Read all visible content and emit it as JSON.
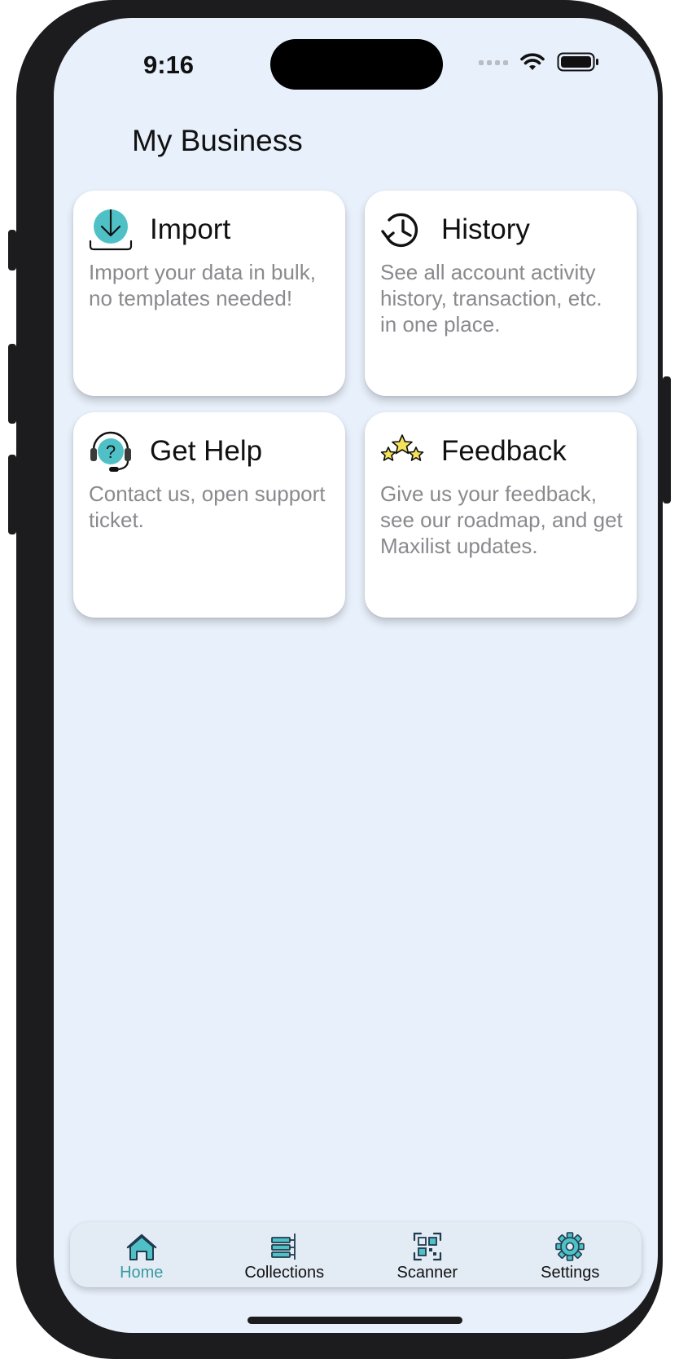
{
  "status_bar": {
    "time": "9:16"
  },
  "header": {
    "title": "My Business"
  },
  "cards": [
    {
      "title": "Import",
      "description": "Import your data in bulk, no templates needed!",
      "icon": "download-icon"
    },
    {
      "title": "History",
      "description": "See all account activity history, transaction, etc. in one place.",
      "icon": "history-clock-icon"
    },
    {
      "title": "Get Help",
      "description": "Contact us, open support ticket.",
      "icon": "headset-help-icon"
    },
    {
      "title": "Feedback",
      "description": "Give us your feedback, see our roadmap, and get Maxilist updates.",
      "icon": "stars-icon"
    }
  ],
  "tabbar": {
    "tabs": [
      {
        "label": "Home",
        "icon": "home-icon",
        "active": true
      },
      {
        "label": "Collections",
        "icon": "collections-icon",
        "active": false
      },
      {
        "label": "Scanner",
        "icon": "qr-scanner-icon",
        "active": false
      },
      {
        "label": "Settings",
        "icon": "gear-icon",
        "active": false
      }
    ]
  },
  "colors": {
    "background": "#e8f0fb",
    "accent": "#4fc1c6",
    "active_tab": "#3a9aa0",
    "description_text": "#8a8a8e",
    "star_fill": "#f5e35a"
  }
}
